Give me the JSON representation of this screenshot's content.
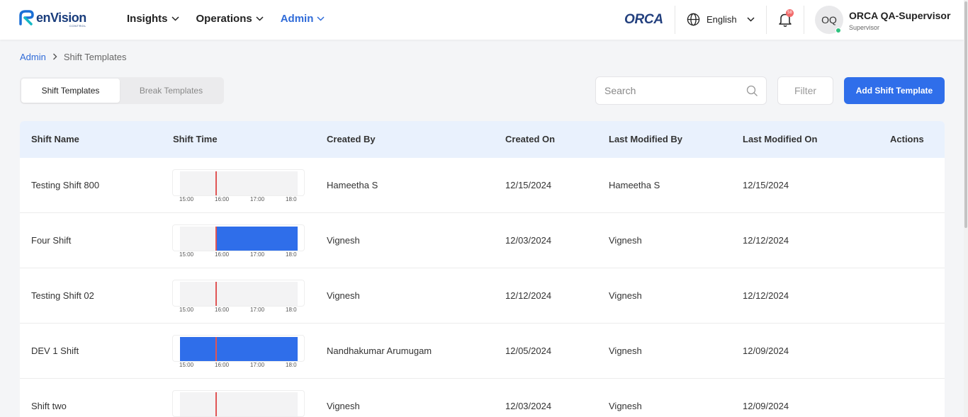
{
  "brand": {
    "name": "enVision",
    "tagline": "CONTROL",
    "partner": "ORCA"
  },
  "nav": [
    {
      "label": "Insights",
      "active": false
    },
    {
      "label": "Operations",
      "active": false
    },
    {
      "label": "Admin",
      "active": true
    }
  ],
  "language": {
    "selected": "English",
    "icon": "globe-icon"
  },
  "notifications": {
    "count": "58",
    "icon": "bell-icon"
  },
  "user": {
    "initials": "OQ",
    "name": "ORCA QA-Supervisor",
    "role": "Supervisor",
    "status_color": "#2ec27e"
  },
  "breadcrumb": {
    "parent": "Admin",
    "current": "Shift Templates"
  },
  "tabs": [
    {
      "label": "Shift Templates",
      "active": true
    },
    {
      "label": "Break Templates",
      "active": false
    }
  ],
  "search": {
    "placeholder": "Search",
    "value": ""
  },
  "filter_label": "Filter",
  "add_button_label": "Add Shift Template",
  "colors": {
    "accent": "#2f6eea",
    "header_bg": "#e9f1fd",
    "now_marker": "#e05555"
  },
  "table": {
    "columns": [
      "Shift Name",
      "Shift Time",
      "Created By",
      "Created On",
      "Last Modified By",
      "Last Modified On",
      "Actions"
    ],
    "timeline_ticks": [
      "15:00",
      "16:00",
      "17:00",
      "18:0"
    ],
    "rows": [
      {
        "name": "Testing Shift 800",
        "created_by": "Hameetha S",
        "created_on": "12/15/2024",
        "modified_by": "Hameetha S",
        "modified_on": "12/15/2024",
        "shift_fill": {
          "start": null,
          "end": null
        }
      },
      {
        "name": "Four Shift",
        "created_by": "Vignesh",
        "created_on": "12/03/2024",
        "modified_by": "Vignesh",
        "modified_on": "12/12/2024",
        "shift_fill": {
          "start": 0.3,
          "end": 1.0
        }
      },
      {
        "name": "Testing Shift 02",
        "created_by": "Vignesh",
        "created_on": "12/12/2024",
        "modified_by": "Vignesh",
        "modified_on": "12/12/2024",
        "shift_fill": {
          "start": null,
          "end": null
        }
      },
      {
        "name": "DEV 1 Shift",
        "created_by": "Nandhakumar Arumugam",
        "created_on": "12/05/2024",
        "modified_by": "Vignesh",
        "modified_on": "12/09/2024",
        "shift_fill": {
          "start": 0.0,
          "end": 1.0
        }
      },
      {
        "name": "Shift two",
        "created_by": "Vignesh",
        "created_on": "12/03/2024",
        "modified_by": "Vignesh",
        "modified_on": "12/09/2024",
        "shift_fill": {
          "start": null,
          "end": null
        }
      }
    ]
  }
}
